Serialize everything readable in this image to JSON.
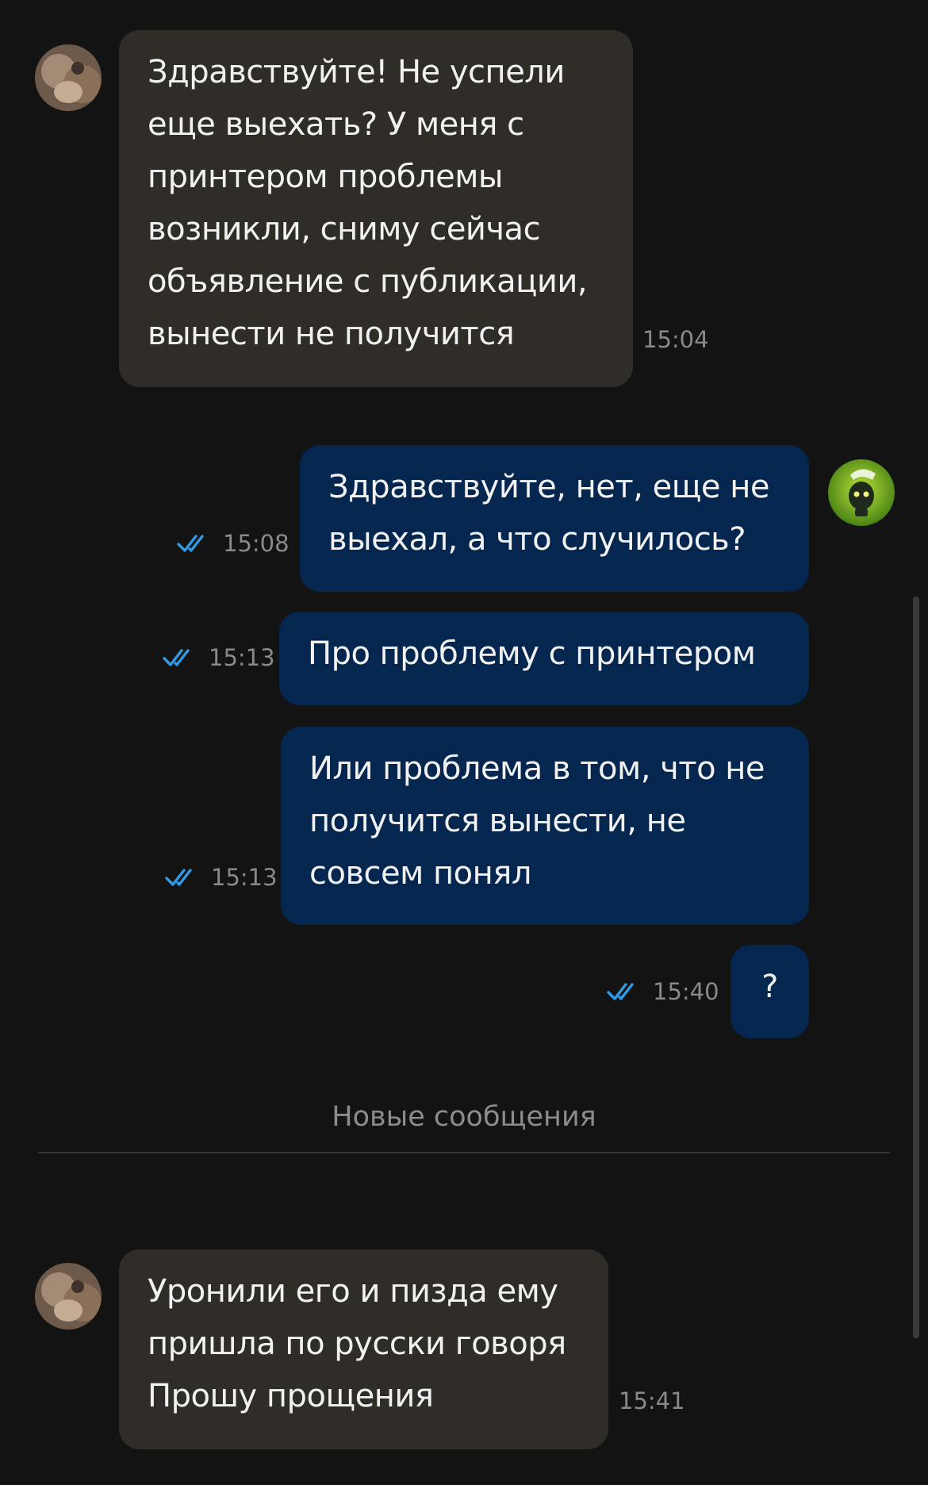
{
  "messages": [
    {
      "id": "m1",
      "direction": "incoming",
      "text": "Здравствуйте! Не успели\nеще выехать? У меня с\nпринтером проблемы\nвозникли, сниму сейчас\nобъявление с публикации,\nвынести не получится",
      "time": "15:04"
    },
    {
      "id": "m2",
      "direction": "outgoing",
      "text": "Здравствуйте, нет, еще не\nвыехал, а что случилось?",
      "time": "15:08",
      "read": true
    },
    {
      "id": "m3",
      "direction": "outgoing",
      "text": "Про проблему с принтером",
      "time": "15:13",
      "read": true
    },
    {
      "id": "m4",
      "direction": "outgoing",
      "text": "Или проблема в том, что не\nполучится вынести, не\nсовсем понял",
      "time": "15:13",
      "read": true
    },
    {
      "id": "m5",
      "direction": "outgoing",
      "text": "?",
      "time": "15:40",
      "read": true
    },
    {
      "id": "m6",
      "direction": "incoming",
      "text": "Уронили его и пизда ему\nпришла по русски говоря\nПрошу прощения",
      "time": "15:41"
    }
  ],
  "divider": {
    "label": "Новые сообщения"
  },
  "colors": {
    "background": "#131313",
    "incoming_bubble": "#302d28",
    "outgoing_bubble": "#05274f",
    "read_check": "#2f9be6",
    "muted_text": "#8a8a8a"
  },
  "icons": {
    "contact_avatar": "contact-avatar",
    "user_avatar": "user-avatar",
    "read_receipt": "double-check-icon"
  }
}
